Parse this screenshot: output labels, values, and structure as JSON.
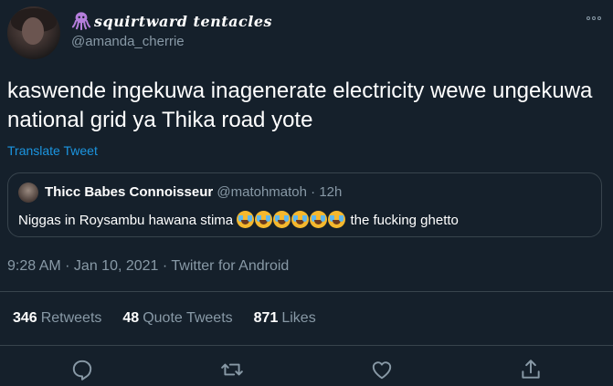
{
  "author": {
    "display_name": "squirtward tentacles",
    "display_name_icon": "octopus-icon",
    "handle": "@amanda_cherrie"
  },
  "tweet": {
    "text": "kaswende ingekuwa inagenerate electricity wewe ungekuwa national grid ya Thika road yote",
    "translate_label": "Translate Tweet",
    "timestamp": "9:28 AM · Jan 10, 2021 · Twitter for Android"
  },
  "quoted_tweet": {
    "name": "Thicc Babes Connoisseur",
    "handle_time": "@matohmatoh · 12h",
    "text_before": "Niggas in Roysambu hawana stima",
    "emoji_count": 6,
    "emoji_name": "face-with-tears-of-joy-emoji",
    "text_after": "the fucking ghetto"
  },
  "stats": [
    {
      "count": "346",
      "label": "Retweets"
    },
    {
      "count": "48",
      "label": "Quote Tweets"
    },
    {
      "count": "871",
      "label": "Likes"
    }
  ],
  "actions": [
    "reply-icon",
    "retweet-icon",
    "like-icon",
    "share-icon"
  ],
  "colors": {
    "background": "#15202b",
    "text": "#ffffff",
    "secondary_text": "#8899a6",
    "link": "#1b95e0",
    "border": "#38444d",
    "display_name_accent": "#b57edc"
  }
}
